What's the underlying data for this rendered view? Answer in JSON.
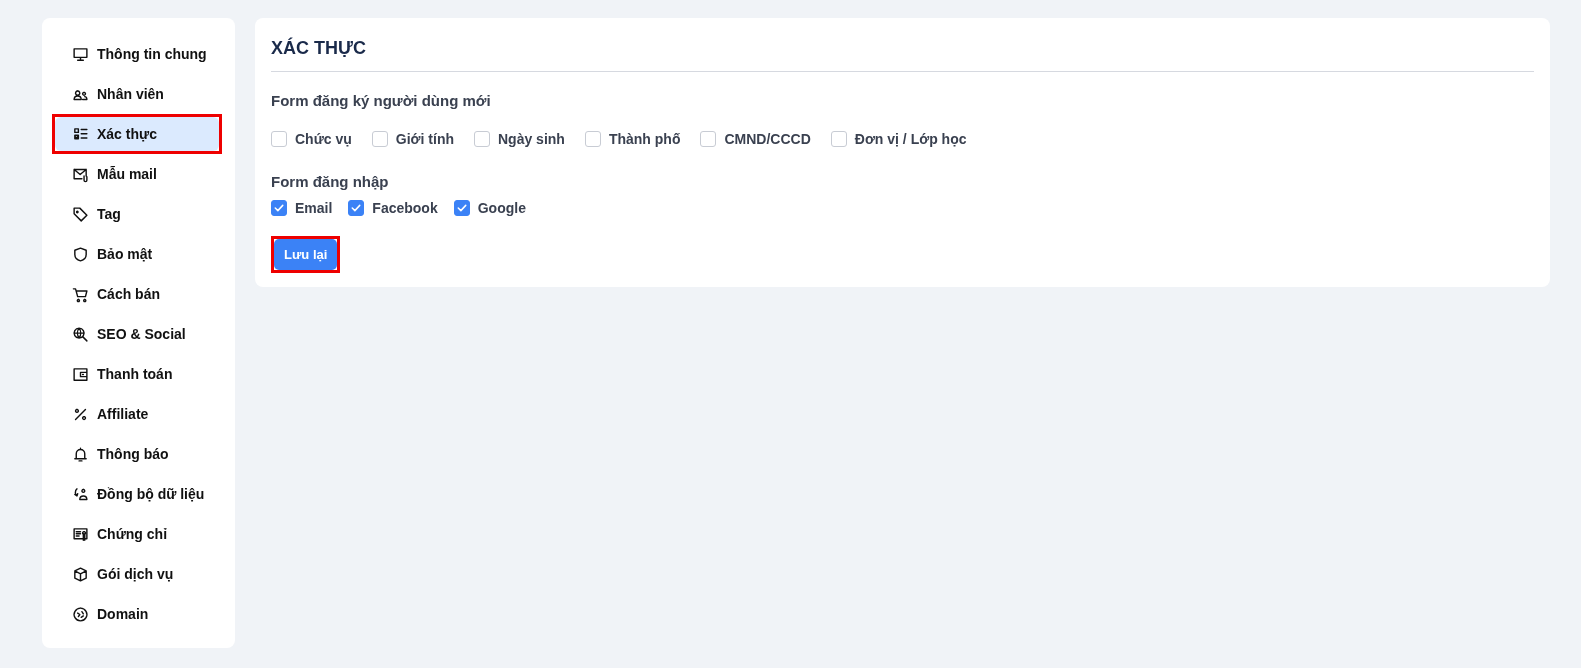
{
  "sidebar": {
    "items": [
      {
        "label": "Thông tin chung",
        "selected": false,
        "annotated": false
      },
      {
        "label": "Nhân viên",
        "selected": false,
        "annotated": false
      },
      {
        "label": "Xác thực",
        "selected": true,
        "annotated": true
      },
      {
        "label": "Mẫu mail",
        "selected": false,
        "annotated": false
      },
      {
        "label": "Tag",
        "selected": false,
        "annotated": false
      },
      {
        "label": "Bảo mật",
        "selected": false,
        "annotated": false
      },
      {
        "label": "Cách bán",
        "selected": false,
        "annotated": false
      },
      {
        "label": "SEO & Social",
        "selected": false,
        "annotated": false
      },
      {
        "label": "Thanh toán",
        "selected": false,
        "annotated": false
      },
      {
        "label": "Affiliate",
        "selected": false,
        "annotated": false
      },
      {
        "label": "Thông báo",
        "selected": false,
        "annotated": false
      },
      {
        "label": "Đồng bộ dữ liệu",
        "selected": false,
        "annotated": false
      },
      {
        "label": "Chứng chỉ",
        "selected": false,
        "annotated": false
      },
      {
        "label": "Gói dịch vụ",
        "selected": false,
        "annotated": false
      },
      {
        "label": "Domain",
        "selected": false,
        "annotated": false
      }
    ]
  },
  "panel": {
    "title": "XÁC THỰC",
    "sections": [
      {
        "heading": "Form đăng ký người dùng mới",
        "options": [
          {
            "label": "Chức vụ",
            "checked": false
          },
          {
            "label": "Giới tính",
            "checked": false
          },
          {
            "label": "Ngày sinh",
            "checked": false
          },
          {
            "label": "Thành phố",
            "checked": false
          },
          {
            "label": "CMND/CCCD",
            "checked": false
          },
          {
            "label": "Đơn vị / Lớp học",
            "checked": false
          }
        ]
      },
      {
        "heading": "Form đăng nhập",
        "options": [
          {
            "label": "Email",
            "checked": true
          },
          {
            "label": "Facebook",
            "checked": true
          },
          {
            "label": "Google",
            "checked": true
          }
        ]
      }
    ],
    "save_button": {
      "label": "Lưu lại",
      "annotated": true
    }
  }
}
